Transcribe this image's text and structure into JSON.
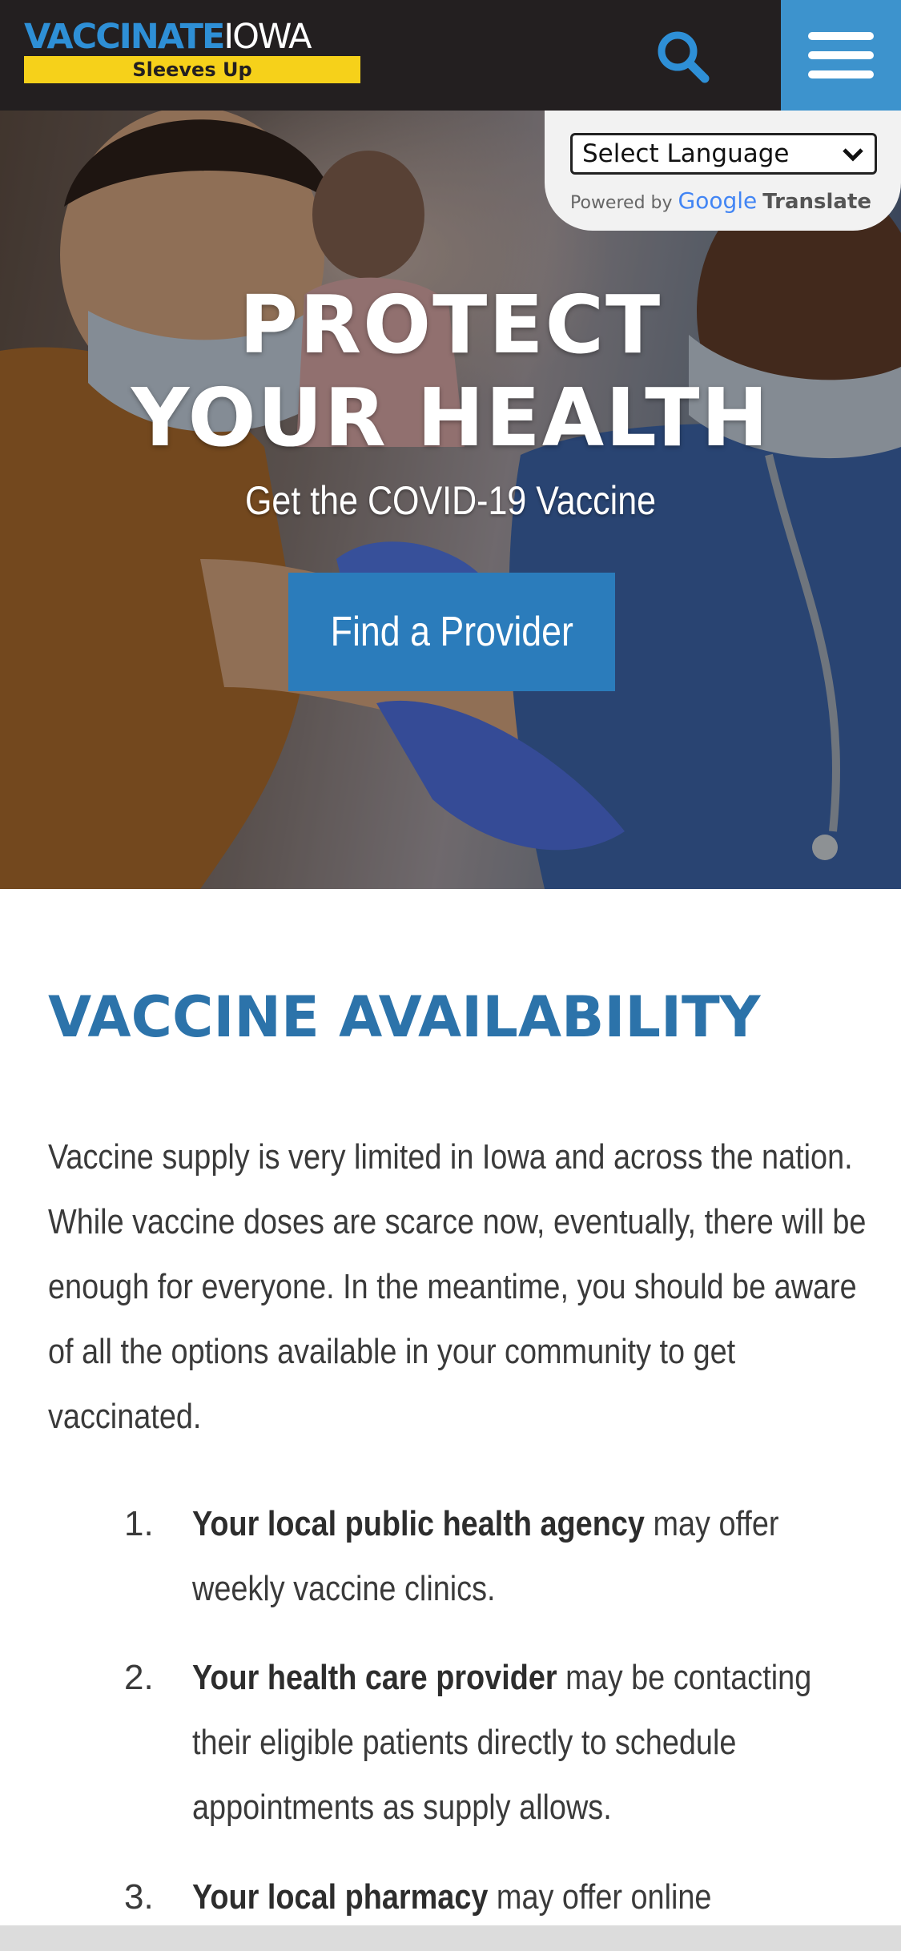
{
  "header": {
    "logo_vaccinate": "VACCINATE",
    "logo_iowa": "IOWA",
    "logo_tagline": "Sleeves Up",
    "search_icon": "search-icon",
    "menu_icon": "hamburger-menu-icon",
    "colors": {
      "bar": "#231f20",
      "logo_blue": "#2e8fd6",
      "tagline_yellow": "#f6d11a",
      "menu_bg": "#3d93cd"
    }
  },
  "translate": {
    "select_value": "Select Language",
    "powered_by": "Powered by",
    "google": "Google",
    "translate_label": "Translate"
  },
  "hero": {
    "title_line1": "PROTECT",
    "title_line2": "YOUR HEALTH",
    "subtitle": "Get the COVID-19 Vaccine",
    "cta_label": "Find a Provider",
    "cta_color": "#2b7cbb"
  },
  "availability": {
    "heading": "VACCINE AVAILABILITY",
    "heading_color": "#2c73aa",
    "intro_lines": [
      "Vaccine supply is very limited in Iowa and across the nation.",
      "While vaccine doses are scarce now, eventually, there will be",
      "enough for everyone. In the meantime, you should be aware",
      "of all the options available in your community to get",
      "vaccinated."
    ],
    "items": [
      {
        "num": "1.",
        "bold": "Your local public health agency",
        "rest": " may offer",
        "lines": [
          "weekly vaccine clinics."
        ]
      },
      {
        "num": "2.",
        "bold": "Your health care provider",
        "rest": " may be contacting",
        "lines": [
          "their eligible patients directly to schedule",
          "appointments as supply allows."
        ]
      },
      {
        "num": "3.",
        "bold": "Your local pharmacy",
        "rest": " may offer online",
        "lines": []
      }
    ]
  }
}
